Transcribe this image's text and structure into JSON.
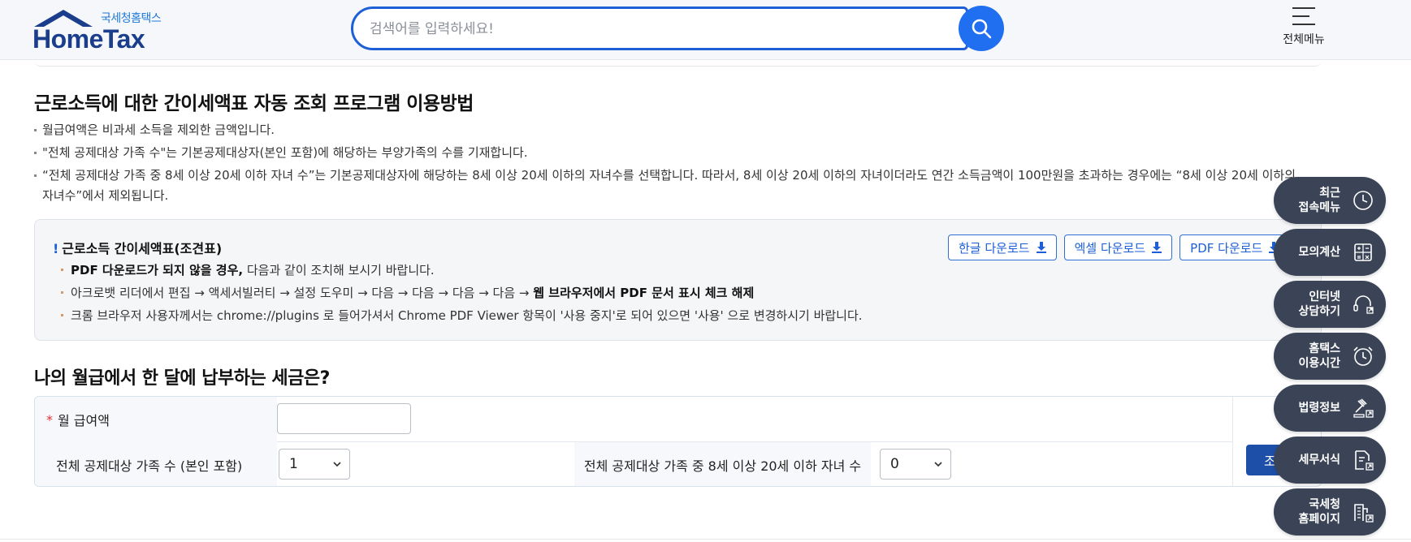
{
  "header": {
    "logo_sub": "국세청홈택스",
    "logo_main": "HomeTax",
    "search_placeholder": "검색어를 입력하세요!",
    "menu_label": "전체메뉴"
  },
  "guide": {
    "title": "근로소득에 대한 간이세액표 자동 조회 프로그램 이용방법",
    "notes": [
      "월급여액은  비과세 소득을 제외한 금액입니다.",
      "\"전체 공제대상 가족 수\"는 기본공제대상자(본인 포함)에 해당하는 부양가족의 수를 기재합니다.",
      "“전체 공제대상 가족 중 8세 이상 20세 이하 자녀 수”는 기본공제대상자에 해당하는 8세 이상 20세 이하의 자녀수를 선택합니다. 따라서, 8세 이상 20세 이하의 자녀이더라도 연간 소득금액이 100만원을 초과하는 경우에는 “8세 이상 20세 이하의 자녀수”에서 제외됩니다."
    ]
  },
  "info": {
    "title": "근로소득 간이세액표(조견표)",
    "bang": "!",
    "line1_bold": "PDF 다운로드가 되지 않을 경우,",
    "line1_rest": " 다음과 같이 조치해 보시기 바랍니다.",
    "line2_rest": "아크로뱃 리더에서 편집 → 액세서빌러티 → 설정 도우미 → 다음 → 다음 → 다음 → 다음 → ",
    "line2_bold": "웹 브라우저에서 PDF 문서 표시 체크 해제",
    "line3": "크롬 브라우저 사용자께서는 chrome://plugins 로 들어가셔서 Chrome PDF Viewer 항목이 '사용 중지'로 되어 있으면 '사용' 으로 변경하시기 바랍니다.",
    "downloads": [
      "한글 다운로드",
      "엑셀 다운로드",
      "PDF 다운로드"
    ]
  },
  "calc": {
    "title": "나의 월급에서 한 달에 납부하는 세금은?",
    "required_mark": "*",
    "salary_label": "월 급여액",
    "salary_value": "",
    "family_label": "전체 공제대상 가족 수 (본인 포함)",
    "family_value": "1",
    "children_label": "전체 공제대상 가족 중 8세 이상 20세 이하 자녀 수",
    "children_value": "0",
    "query_button": "조회"
  },
  "quick_menu": [
    {
      "label": "최근\n접속메뉴",
      "icon": "clock-icon"
    },
    {
      "label": "모의계산",
      "icon": "calculator-icon"
    },
    {
      "label": "인터넷\n상담하기",
      "icon": "headset-icon"
    },
    {
      "label": "홈택스\n이용시간",
      "icon": "alarm-clock-icon"
    },
    {
      "label": "법령정보",
      "icon": "gavel-icon"
    },
    {
      "label": "세무서식",
      "icon": "document-icon"
    },
    {
      "label": "국세청\n홈페이지",
      "icon": "building-icon"
    }
  ],
  "colors": {
    "brand": "#1b3e8c",
    "accent": "#1f6ff0",
    "quick_bg": "#3a4456",
    "query_button": "#1d4fa8",
    "required": "#e03030"
  }
}
